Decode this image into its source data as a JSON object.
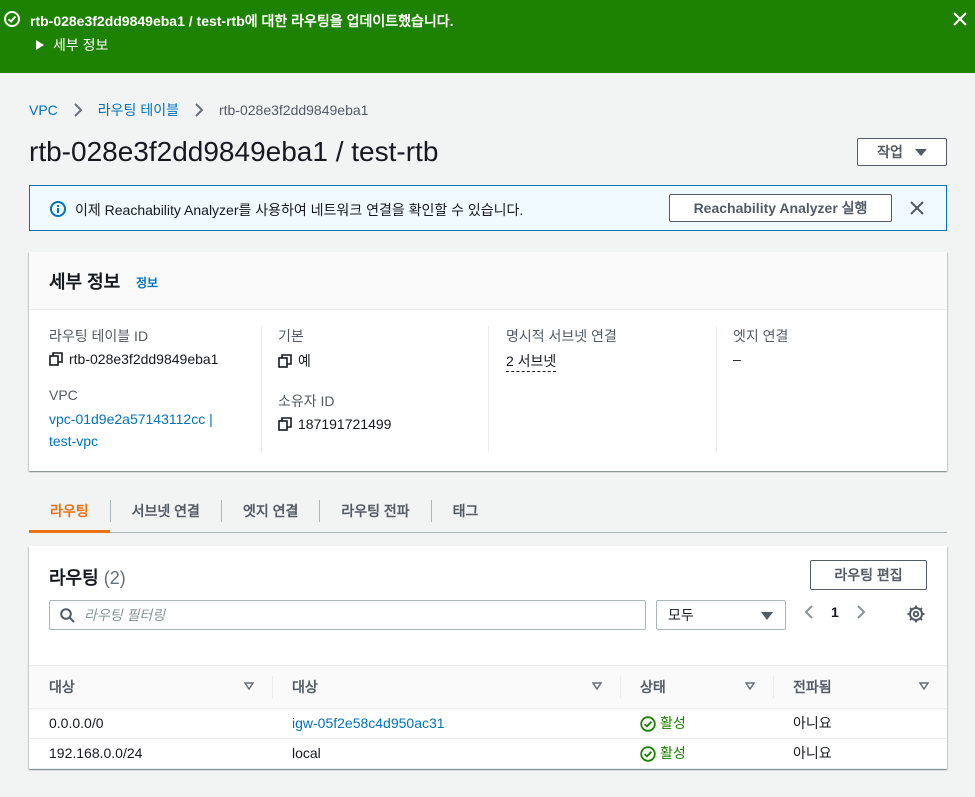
{
  "flash": {
    "message": "rtb-028e3f2dd9849eba1 / test-rtb에 대한 라우팅을 업데이트했습니다.",
    "details_toggle": "세부 정보",
    "color": "#1d8102"
  },
  "breadcrumb": {
    "items": [
      "VPC",
      "라우팅 테이블",
      "rtb-028e3f2dd9849eba1"
    ]
  },
  "page": {
    "title": "rtb-028e3f2dd9849eba1 / test-rtb",
    "actions_label": "작업"
  },
  "info_alert": {
    "text": "이제 Reachability Analyzer를 사용하여 네트워크 연결을 확인할 수 있습니다.",
    "button": "Reachability Analyzer 실행"
  },
  "details": {
    "title": "세부 정보",
    "info_link": "정보",
    "fields": {
      "route_table_id_label": "라우팅 테이블 ID",
      "route_table_id": "rtb-028e3f2dd9849eba1",
      "vpc_label": "VPC",
      "vpc_line1": "vpc-01d9e2a57143112cc |",
      "vpc_line2": "test-vpc",
      "main_label": "기본",
      "main_value": "예",
      "owner_label": "소유자 ID",
      "owner_value": "187191721499",
      "explicit_subnet_label": "명시적 서브넷 연결",
      "explicit_subnet_value": "2 서브넷",
      "edge_label": "엣지 연결",
      "edge_value": "–"
    }
  },
  "tabs": [
    {
      "label": "라우팅",
      "active": true
    },
    {
      "label": "서브넷 연결",
      "active": false
    },
    {
      "label": "엣지 연결",
      "active": false
    },
    {
      "label": "라우팅 전파",
      "active": false
    },
    {
      "label": "태그",
      "active": false
    }
  ],
  "routes": {
    "title": "라우팅",
    "count": "(2)",
    "edit_button": "라우팅 편집",
    "filter_placeholder": "라우팅 필터링",
    "filter_select": "모두",
    "page": "1",
    "columns": [
      "대상",
      "대상",
      "상태",
      "전파됨"
    ],
    "rows": [
      {
        "destination": "0.0.0.0/0",
        "target": "igw-05f2e58c4d950ac31",
        "status": "활성",
        "propagated": "아니요"
      },
      {
        "destination": "192.168.0.0/24",
        "target": "local",
        "status": "활성",
        "propagated": "아니요"
      }
    ]
  },
  "colors": {
    "link": "#0073bb",
    "active_tab": "#ec7211",
    "success": "#1d8102",
    "info_border": "#0073bb"
  }
}
